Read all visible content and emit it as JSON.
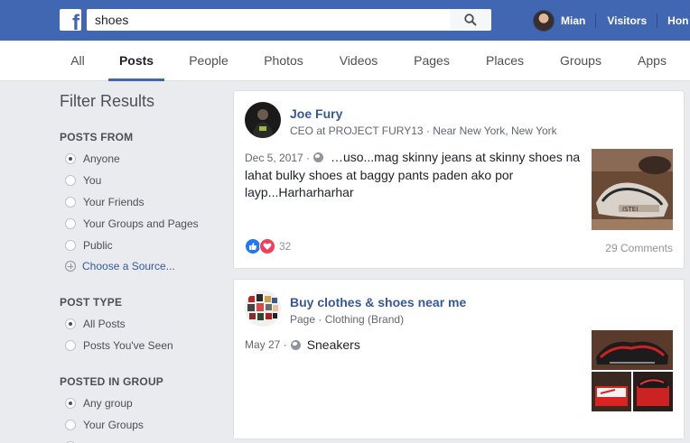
{
  "header": {
    "search_value": "shoes",
    "user_name": "Mian",
    "nav_visitors": "Visitors",
    "nav_home": "Hon"
  },
  "tabs": [
    {
      "label": "All"
    },
    {
      "label": "Posts"
    },
    {
      "label": "People"
    },
    {
      "label": "Photos"
    },
    {
      "label": "Videos"
    },
    {
      "label": "Pages"
    },
    {
      "label": "Places"
    },
    {
      "label": "Groups"
    },
    {
      "label": "Apps"
    }
  ],
  "sidebar": {
    "title": "Filter Results",
    "posts_from": {
      "heading": "POSTS FROM",
      "options": [
        "Anyone",
        "You",
        "Your Friends",
        "Your Groups and Pages",
        "Public"
      ],
      "selected": "Anyone",
      "choose_source": "Choose a Source..."
    },
    "post_type": {
      "heading": "POST TYPE",
      "options": [
        "All Posts",
        "Posts You've Seen"
      ],
      "selected": "All Posts"
    },
    "posted_in_group": {
      "heading": "POSTED IN GROUP",
      "options": [
        "Any group",
        "Your Groups"
      ],
      "selected": "Any group"
    }
  },
  "posts": [
    {
      "author": "Joe Fury",
      "subtitle": "CEO at PROJECT FURY13 · Near New York, New York",
      "date": "Dec 5, 2017 ·",
      "text": "…uso...mag skinny jeans at skinny shoes na lahat bulky shoes at baggy pants paden ako por layp...Harharharhar",
      "reaction_count": "32",
      "comments": "29 Comments"
    },
    {
      "author": "Buy clothes & shoes near me",
      "subtitle": "Page · Clothing (Brand)",
      "date": "May 27 ·",
      "text": "Sneakers"
    }
  ],
  "colors": {
    "brand_blue": "#4267b2",
    "link_blue": "#365899",
    "background": "#e9ebee",
    "like_blue": "#2078f4",
    "love_red": "#f33e58"
  }
}
